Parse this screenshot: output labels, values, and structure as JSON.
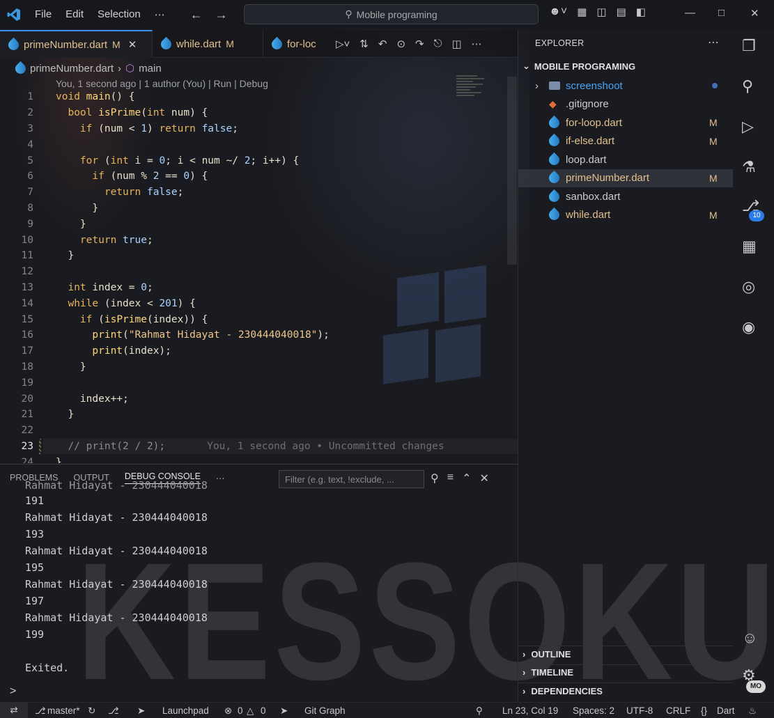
{
  "titlebar": {
    "menu": [
      "File",
      "Edit",
      "Selection",
      "⋯"
    ],
    "search": "Mobile programing"
  },
  "tabs": [
    {
      "name": "primeNumber.dart",
      "status": "M",
      "close": "✕"
    },
    {
      "name": "while.dart",
      "status": "M"
    },
    {
      "name": "for-loc"
    }
  ],
  "breadcrumb": {
    "file": "primeNumber.dart",
    "symbol": "main"
  },
  "blame_line": "You, 1 second ago | 1 author (You) | Run | Debug",
  "code": {
    "line_numbers": [
      "1",
      "2",
      "3",
      "4",
      "5",
      "6",
      "7",
      "8",
      "9",
      "10",
      "11",
      "12",
      "13",
      "14",
      "15",
      "16",
      "17",
      "18",
      "19",
      "20",
      "21",
      "22",
      "23",
      "24"
    ],
    "current_line": "23",
    "inline_blame": "You, 1 second ago • Uncommitted changes"
  },
  "panel": {
    "tabs": [
      "PROBLEMS",
      "OUTPUT",
      "DEBUG CONSOLE",
      "⋯"
    ],
    "filter_placeholder": "Filter (e.g. text, !exclude, ...",
    "console_lines": [
      "Rahmat Hidayat - 230444040018",
      "191",
      "Rahmat Hidayat - 230444040018",
      "193",
      "Rahmat Hidayat - 230444040018",
      "195",
      "Rahmat Hidayat - 230444040018",
      "197",
      "Rahmat Hidayat - 230444040018",
      "199",
      "",
      "Exited."
    ],
    "prompt": ">"
  },
  "explorer": {
    "title": "EXPLORER",
    "folder": "MOBILE PROGRAMING",
    "items": [
      {
        "label": "screenshoot",
        "kind": "folder",
        "badge": ""
      },
      {
        "label": ".gitignore",
        "kind": "git",
        "badge": ""
      },
      {
        "label": "for-loop.dart",
        "kind": "dart",
        "badge": "M"
      },
      {
        "label": "if-else.dart",
        "kind": "dart",
        "badge": "M"
      },
      {
        "label": "loop.dart",
        "kind": "dart",
        "badge": ""
      },
      {
        "label": "primeNumber.dart",
        "kind": "dart",
        "badge": "M"
      },
      {
        "label": "sanbox.dart",
        "kind": "dart",
        "badge": ""
      },
      {
        "label": "while.dart",
        "kind": "dart",
        "badge": "M"
      }
    ],
    "sections": [
      "OUTLINE",
      "TIMELINE",
      "DEPENDENCIES"
    ]
  },
  "activity": {
    "scm_count": "10",
    "account_badge": "MO"
  },
  "statusbar": {
    "branch": "master*",
    "launchpad": "Launchpad",
    "errors": "0",
    "warnings": "0",
    "gitgraph": "Git Graph",
    "position": "Ln 23, Col 19",
    "spaces": "Spaces: 2",
    "encoding": "UTF-8",
    "eol": "CRLF",
    "language": "Dart"
  },
  "watermark": "KESSOKU",
  "colors": {
    "accent": "#3b8eea",
    "modified": "#e2c08d",
    "badge": "#2b7de9"
  }
}
